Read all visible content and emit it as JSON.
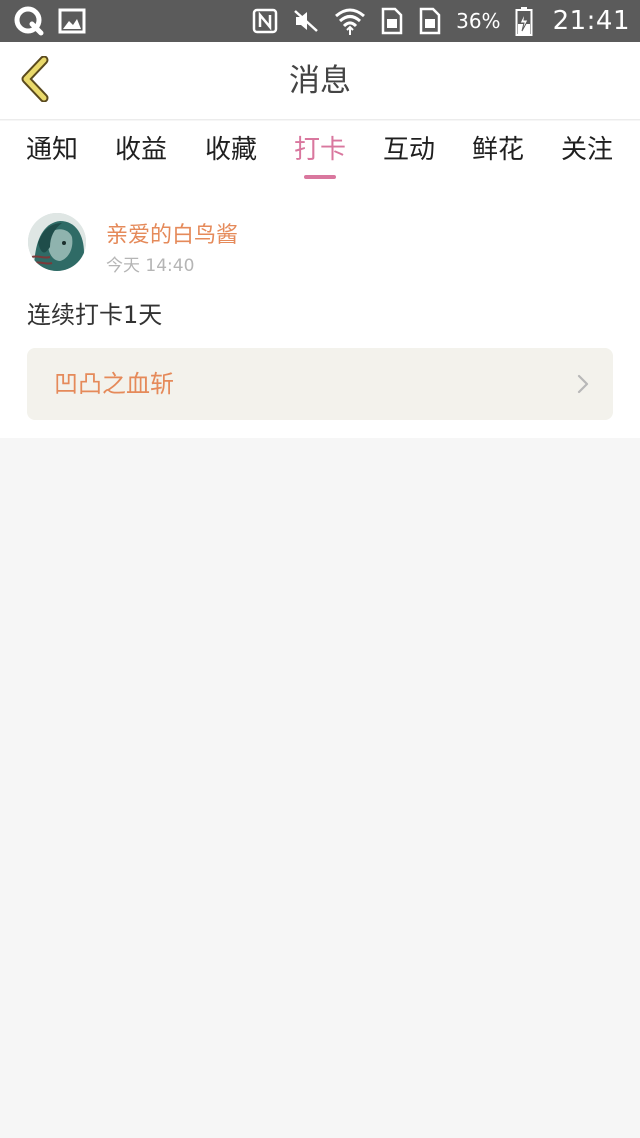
{
  "status_bar": {
    "battery_percent": "36%",
    "time": "21:41",
    "icons": [
      "app-q-icon",
      "image-icon",
      "nfc-icon",
      "mute-icon",
      "wifi-icon",
      "sim1-icon",
      "sim2-icon",
      "battery-charging-icon"
    ]
  },
  "header": {
    "title": "消息",
    "back_icon": "chevron-left-icon",
    "accent_color": "#d9779e",
    "back_icon_color": "#e9d96b"
  },
  "tabs": [
    {
      "label": "通知"
    },
    {
      "label": "收益"
    },
    {
      "label": "收藏"
    },
    {
      "label": "打卡",
      "active": true
    },
    {
      "label": "互动"
    },
    {
      "label": "鲜花"
    },
    {
      "label": "关注"
    }
  ],
  "message": {
    "username": "亲爱的白鸟酱",
    "time": "今天 14:40",
    "text": "连续打卡1天",
    "linked_item": {
      "title": "凹凸之血斩",
      "chevron_icon": "chevron-right-icon"
    },
    "name_color": "#e58a5a"
  }
}
